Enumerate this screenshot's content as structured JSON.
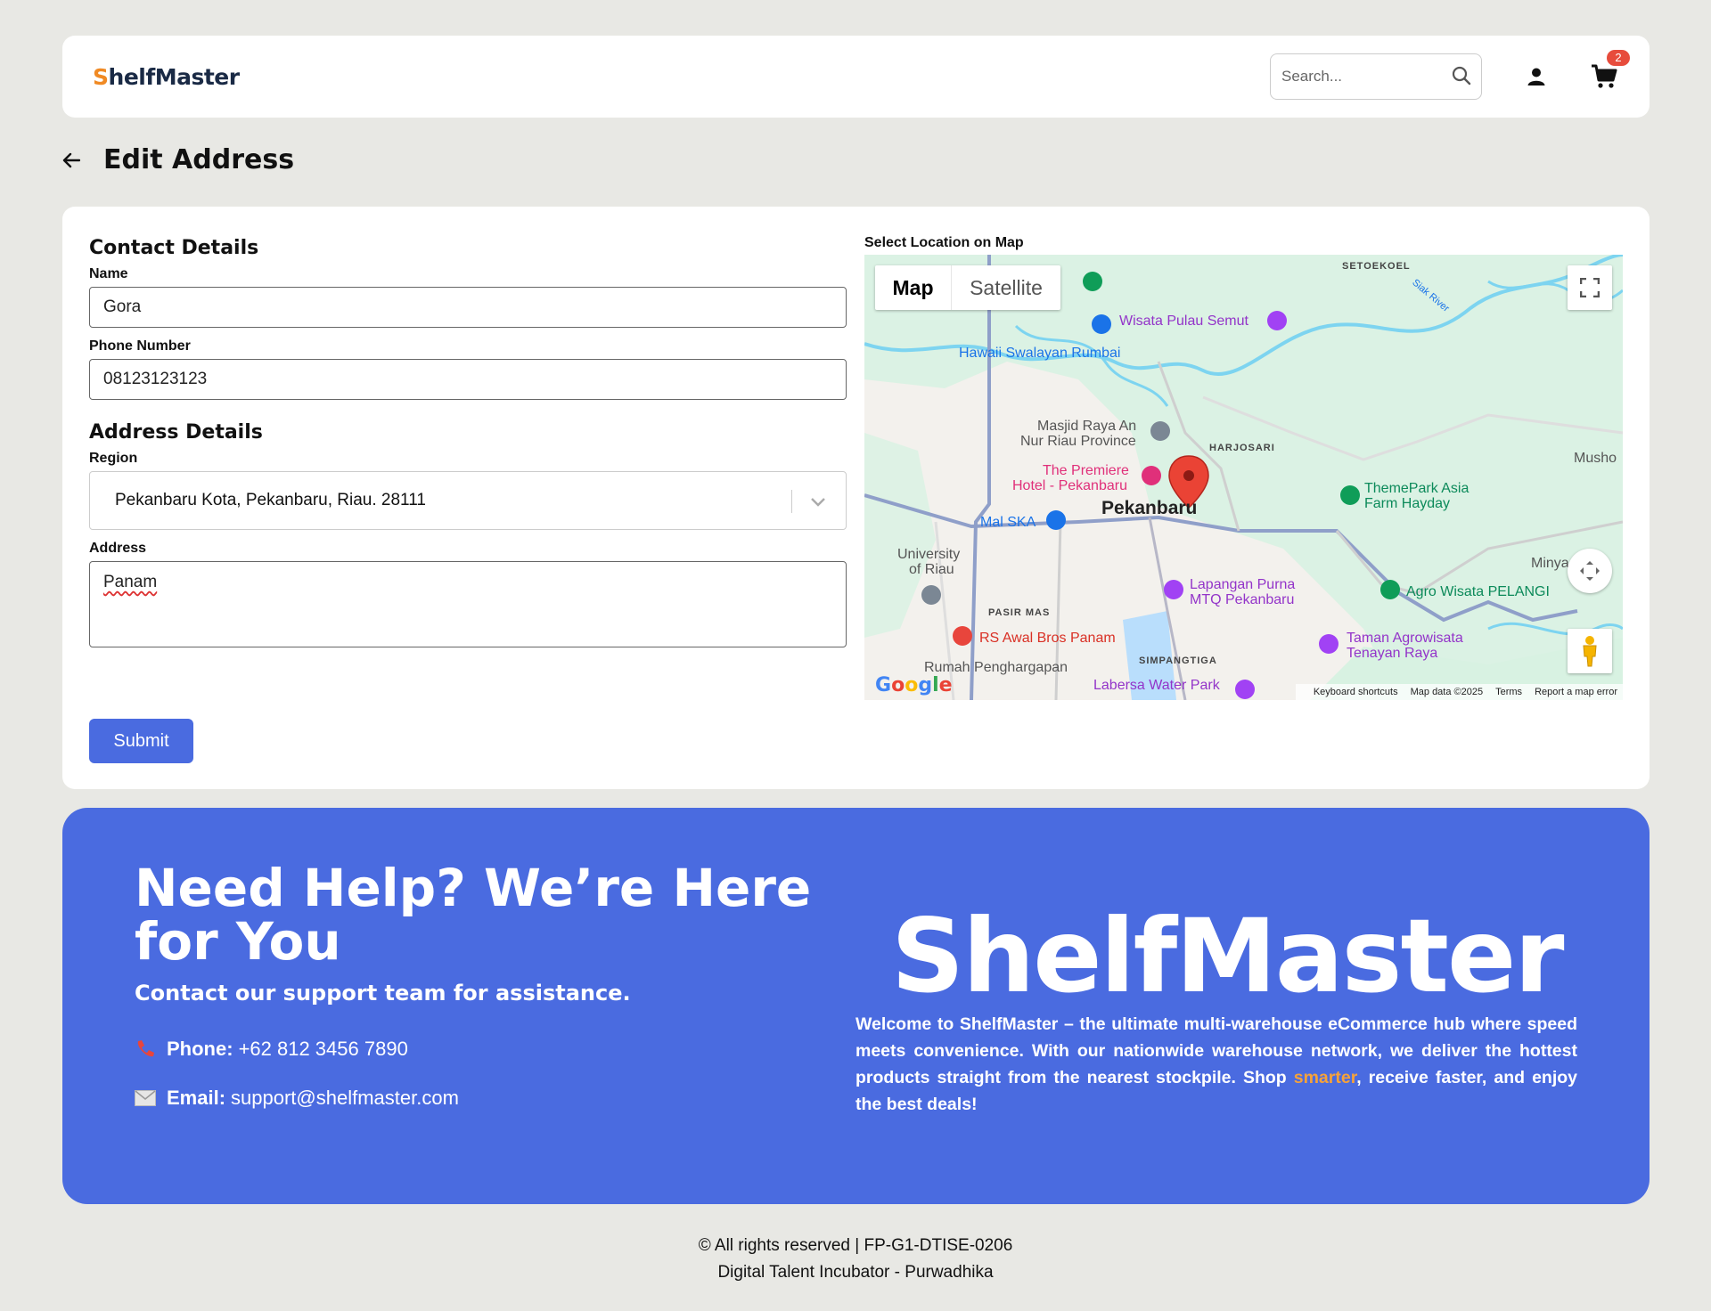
{
  "header": {
    "logo_first": "S",
    "logo_rest": "helfMaster",
    "search_placeholder": "Search...",
    "cart_count": "2"
  },
  "page": {
    "title": "Edit Address"
  },
  "form": {
    "contact_section": "Contact Details",
    "name_label": "Name",
    "name_value": "Gora",
    "phone_label": "Phone Number",
    "phone_value": "08123123123",
    "address_section": "Address Details",
    "region_label": "Region",
    "region_value": "Pekanbaru Kota, Pekanbaru, Riau. 28111",
    "address_label": "Address",
    "address_value": "Panam",
    "submit_label": "Submit"
  },
  "map": {
    "label": "Select Location on Map",
    "tab_map": "Map",
    "tab_satellite": "Satellite",
    "footer_shortcuts": "Keyboard shortcuts",
    "footer_data": "Map data ©2025",
    "footer_terms": "Terms",
    "footer_report": "Report a map error",
    "places": {
      "wisata_pulau_semut": "Wisata Pulau Semut",
      "hawaii_swalayan": "Hawaii Swalayan Rumbai",
      "masjid_1": "Masjid Raya An",
      "masjid_2": "Nur Riau Province",
      "premiere_1": "The Premiere",
      "premiere_2": "Hotel - Pekanbaru",
      "mal_ska": "Mal SKA",
      "pekanbaru": "Pekanbaru",
      "univ_1": "University",
      "univ_2": "of Riau",
      "themepark_1": "ThemePark Asia",
      "themepark_2": "Farm Hayday",
      "lapangan_1": "Lapangan Purna",
      "lapangan_2": "MTQ Pekanbaru",
      "agro": "Agro Wisata PELANGI",
      "rs_awal": "RS Awal Bros Panam",
      "taman_1": "Taman Agrowisata",
      "taman_2": "Tenayan Raya",
      "rumah": "Rumah Penghargapan",
      "labersa": "Labersa Water Park",
      "setoekoel": "SETOEKOEL",
      "harjosari": "HARJOSARI",
      "pasir_mas": "PASIR MAS",
      "simpangtiga": "SIMPANGTIGA",
      "musho": "Musho",
      "minya": "Minya",
      "siak_river": "Siak River",
      "google": "Google"
    }
  },
  "help": {
    "title": "Need Help? We’re Here for You",
    "subtitle": "Contact our support team for assistance.",
    "phone_label": "Phone:",
    "phone_value": "+62 812 3456 7890",
    "email_label": "Email:",
    "email_value": "support@shelfmaster.com",
    "brand": "ShelfMaster",
    "desc_before": "Welcome to ShelfMaster – the ultimate multi-warehouse eCommerce hub where speed meets convenience. With our nationwide warehouse network, we deliver the hottest products straight from the nearest stockpile. Shop ",
    "desc_highlight": "smarter",
    "desc_after": ", receive faster, and enjoy the best deals!"
  },
  "footer": {
    "line1": "© All rights reserved | FP-G1-DTISE-0206",
    "line2": "Digital Talent Incubator - Purwadhika"
  },
  "colors": {
    "primary": "#4a6be0",
    "logo_accent": "#f08a24",
    "badge": "#e74c3c",
    "highlight": "#f6a23a"
  }
}
